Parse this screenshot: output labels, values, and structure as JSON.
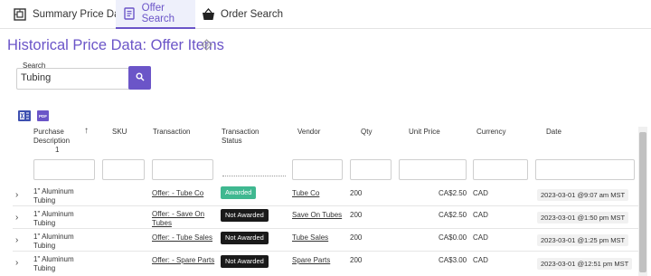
{
  "tabs": [
    {
      "label": "Summary Price Data",
      "icon": "chart-frame-icon"
    },
    {
      "label": "Offer Search",
      "icon": "document-list-icon",
      "active": true
    },
    {
      "label": "Order Search",
      "icon": "basket-icon"
    }
  ],
  "page": {
    "title": "Historical Price Data: Offer Items"
  },
  "search": {
    "label": "Search",
    "value": "Tubing"
  },
  "columns": {
    "description": "Purchase Description",
    "description_sort_index": "1",
    "sku": "SKU",
    "transaction": "Transaction",
    "status": "Transaction Status",
    "vendor": "Vendor",
    "qty": "Qty",
    "unit_price": "Unit Price",
    "currency": "Currency",
    "date": "Date"
  },
  "rows": [
    {
      "description": "1\" Aluminum Tubing",
      "transaction": "Offer: - Tube Co",
      "status": "Awarded",
      "vendor": "Tube Co",
      "qty": "200",
      "unit_price": "CA$2.50",
      "currency": "CAD",
      "date": "2023-03-01 @9:07 am MST"
    },
    {
      "description": "1\" Aluminum Tubing",
      "transaction": "Offer: - Save On Tubes",
      "status": "Not Awarded",
      "vendor": "Save On Tubes",
      "qty": "200",
      "unit_price": "CA$2.50",
      "currency": "CAD",
      "date": "2023-03-01 @1:50 pm MST"
    },
    {
      "description": "1\" Aluminum Tubing",
      "transaction": "Offer: - Tube Sales",
      "status": "Not Awarded",
      "vendor": "Tube Sales",
      "qty": "200",
      "unit_price": "CA$0.00",
      "currency": "CAD",
      "date": "2023-03-01 @1:25 pm MST"
    },
    {
      "description": "1\" Aluminum Tubing",
      "transaction": "Offer: - Spare Parts",
      "status": "Not Awarded",
      "vendor": "Spare Parts",
      "qty": "200",
      "unit_price": "CA$3.00",
      "currency": "CAD",
      "date": "2023-03-01 @12:51 pm MST"
    }
  ],
  "colors": {
    "accent": "#6b55c8",
    "awarded": "#3fb890",
    "not_awarded": "#1a1a1a"
  }
}
